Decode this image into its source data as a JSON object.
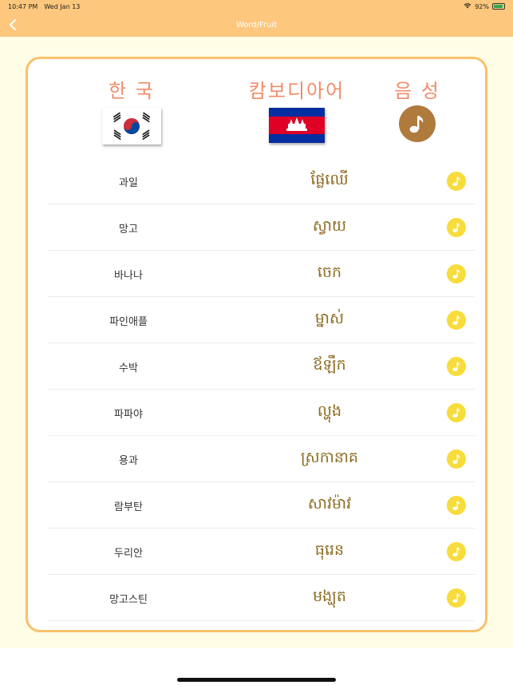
{
  "status": {
    "time": "10:47 PM",
    "date": "Wed Jan 13",
    "battery": "92%",
    "battery_level": 0.92
  },
  "nav": {
    "title": "Word/Fruit"
  },
  "header": {
    "korean": "한 국",
    "cambodian": "캄보디아어",
    "audio": "음 성"
  },
  "colors": {
    "bar": "#fdc77d",
    "border": "#f8c16a",
    "header_text": "#f08c6a",
    "khmer_text": "#8c6a1f",
    "sound_button": "#f7dc3c",
    "big_note_bg": "#b07a3c"
  },
  "words": [
    {
      "ko": "과일",
      "km": "ផ្លែឈើ"
    },
    {
      "ko": "망고",
      "km": "ស្វាយ"
    },
    {
      "ko": "바나나",
      "km": "ចេក"
    },
    {
      "ko": "파인애플",
      "km": "ម្នាស់"
    },
    {
      "ko": "수박",
      "km": "ឪឡឹក"
    },
    {
      "ko": "파파야",
      "km": "ល្ហុង"
    },
    {
      "ko": "용과",
      "km": "ស្រកានាគ"
    },
    {
      "ko": "람부탄",
      "km": "សាវម៉ាវ"
    },
    {
      "ko": "두리안",
      "km": "ធុរេន"
    },
    {
      "ko": "망고스틴",
      "km": "មង្ឃុត"
    }
  ]
}
